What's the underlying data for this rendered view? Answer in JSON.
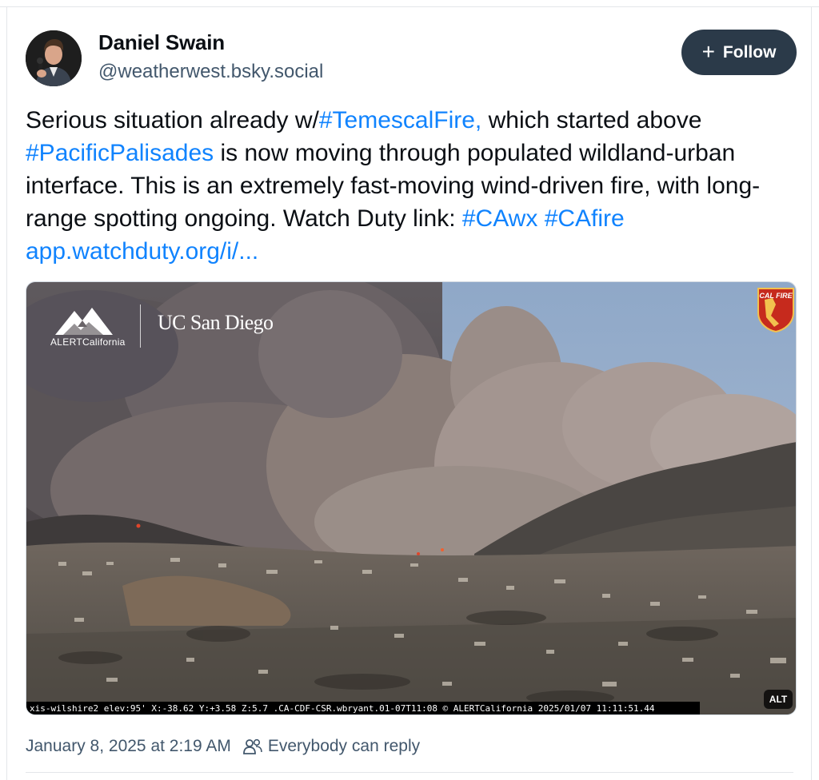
{
  "author": {
    "display_name": "Daniel Swain",
    "handle": "@weatherwest.bsky.social"
  },
  "follow_button": {
    "icon": "plus-icon",
    "label": "Follow"
  },
  "post": {
    "segments": [
      {
        "text": "Serious situation already w/",
        "link": false
      },
      {
        "text": "#TemescalFire,",
        "link": true
      },
      {
        "text": " which started above ",
        "link": false
      },
      {
        "text": "#PacificPalisades",
        "link": true
      },
      {
        "text": " is now moving through populated wildland-urban interface. This is an extremely fast-moving wind-driven fire, with long-range spotting ongoing. Watch Duty link: ",
        "link": false
      },
      {
        "text": "#CAwx",
        "link": true
      },
      {
        "text": " ",
        "link": false
      },
      {
        "text": "#CAfire",
        "link": true
      },
      {
        "text": " ",
        "link": false
      },
      {
        "text": "app.watchduty.org/i/...",
        "link": true
      }
    ]
  },
  "media": {
    "watermark_alert": "ALERTCalifornia",
    "watermark_ucsd": "UC San Diego",
    "badge_text": "CAL FIRE",
    "caption": "xis-wilshire2 elev:95' X:-38.62 Y:+3.58 Z:5.7 .CA-CDF-CSR.wbryant.01-07T11:08 © ALERTCalifornia 2025/01/07  11:11:51.44",
    "alt_label": "ALT"
  },
  "meta": {
    "timestamp": "January 8, 2025 at 2:19 AM",
    "reply_icon": "people-icon",
    "reply_setting": "Everybody can reply"
  },
  "colors": {
    "link": "#1083fe",
    "follow_bg": "#2b3a49",
    "muted": "#42576c"
  }
}
